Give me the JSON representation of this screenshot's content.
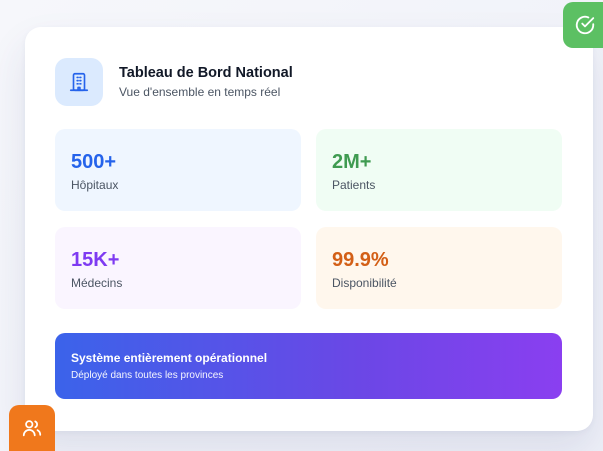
{
  "header": {
    "title": "Tableau de Bord National",
    "subtitle": "Vue d'ensemble en temps réel",
    "icon": "building-icon"
  },
  "stats": [
    {
      "value": "500+",
      "label": "Hôpitaux",
      "color": "#2563eb"
    },
    {
      "value": "2M+",
      "label": "Patients",
      "color": "#3f9b51"
    },
    {
      "value": "15K+",
      "label": "Médecins",
      "color": "#7e3af2"
    },
    {
      "value": "99.9%",
      "label": "Disponibilité",
      "color": "#d35f16"
    }
  ],
  "banner": {
    "title": "Système entièrement opérationnel",
    "subtitle": "Déployé dans toutes les provinces"
  },
  "badges": {
    "check": {
      "icon": "check-circle-icon",
      "color": "#5cc063"
    },
    "users": {
      "icon": "users-icon",
      "color": "#f0781c"
    }
  }
}
